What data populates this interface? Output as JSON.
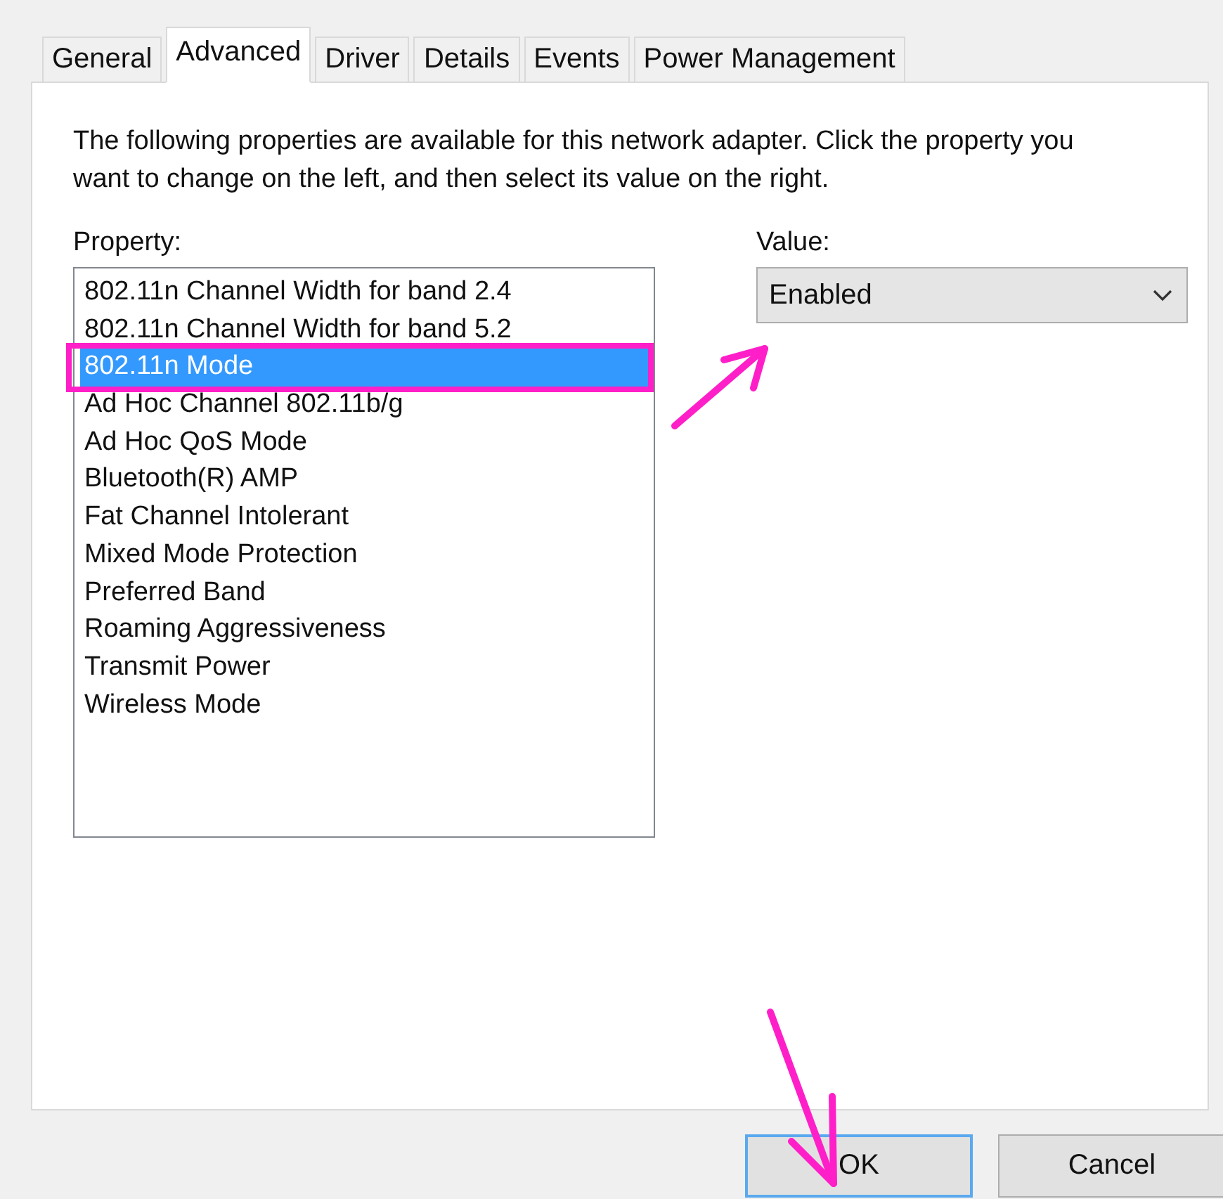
{
  "tabs": [
    {
      "label": "General",
      "selected": false
    },
    {
      "label": "Advanced",
      "selected": true
    },
    {
      "label": "Driver",
      "selected": false
    },
    {
      "label": "Details",
      "selected": false
    },
    {
      "label": "Events",
      "selected": false
    },
    {
      "label": "Power Management",
      "selected": false
    }
  ],
  "description": "The following properties are available for this network adapter. Click the property you want to change on the left, and then select its value on the right.",
  "property": {
    "label": "Property:",
    "items": [
      {
        "label": "802.11n Channel Width for band 2.4",
        "selected": false
      },
      {
        "label": "802.11n Channel Width for band 5.2",
        "selected": false
      },
      {
        "label": "802.11n Mode",
        "selected": true
      },
      {
        "label": "Ad Hoc Channel 802.11b/g",
        "selected": false
      },
      {
        "label": "Ad Hoc QoS Mode",
        "selected": false
      },
      {
        "label": "Bluetooth(R) AMP",
        "selected": false
      },
      {
        "label": "Fat Channel Intolerant",
        "selected": false
      },
      {
        "label": "Mixed Mode Protection",
        "selected": false
      },
      {
        "label": "Preferred Band",
        "selected": false
      },
      {
        "label": "Roaming Aggressiveness",
        "selected": false
      },
      {
        "label": "Transmit Power",
        "selected": false
      },
      {
        "label": "Wireless Mode",
        "selected": false
      }
    ]
  },
  "value": {
    "label": "Value:",
    "selected": "Enabled"
  },
  "buttons": [
    {
      "label": "OK",
      "kind": "default"
    },
    {
      "label": "Cancel",
      "kind": "normal"
    }
  ]
}
